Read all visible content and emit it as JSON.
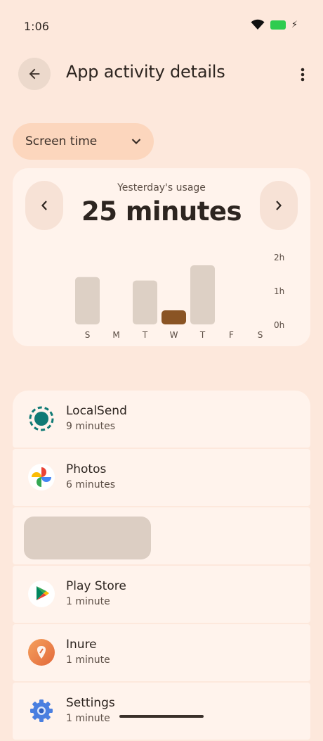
{
  "status_bar": {
    "time": "1:06"
  },
  "header": {
    "title": "App activity details"
  },
  "filter": {
    "label": "Screen time"
  },
  "usage": {
    "caption": "Yesterday's usage",
    "value": "25 minutes"
  },
  "chart_data": {
    "type": "bar",
    "categories": [
      "S",
      "M",
      "T",
      "W",
      "T",
      "F",
      "S"
    ],
    "values": [
      1.4,
      0,
      1.3,
      0.4,
      1.75,
      0,
      0
    ],
    "highlight_index": 3,
    "y_ticks": [
      "0h",
      "1h",
      "2h"
    ],
    "ylim": [
      0,
      2
    ],
    "unit": "hours",
    "colors": {
      "bar": "#ddd0c5",
      "highlight": "#8a5424"
    }
  },
  "apps": [
    {
      "name": "LocalSend",
      "time": "9 minutes",
      "icon": "localsend-icon"
    },
    {
      "name": "Photos",
      "time": "6 minutes",
      "icon": "photos-icon"
    },
    {
      "name": "",
      "time": "",
      "icon": ""
    },
    {
      "name": "Play Store",
      "time": "1 minute",
      "icon": "play-store-icon"
    },
    {
      "name": "Inure",
      "time": "1 minute",
      "icon": "inure-icon"
    },
    {
      "name": "Settings",
      "time": "1 minute",
      "icon": "settings-icon"
    }
  ]
}
